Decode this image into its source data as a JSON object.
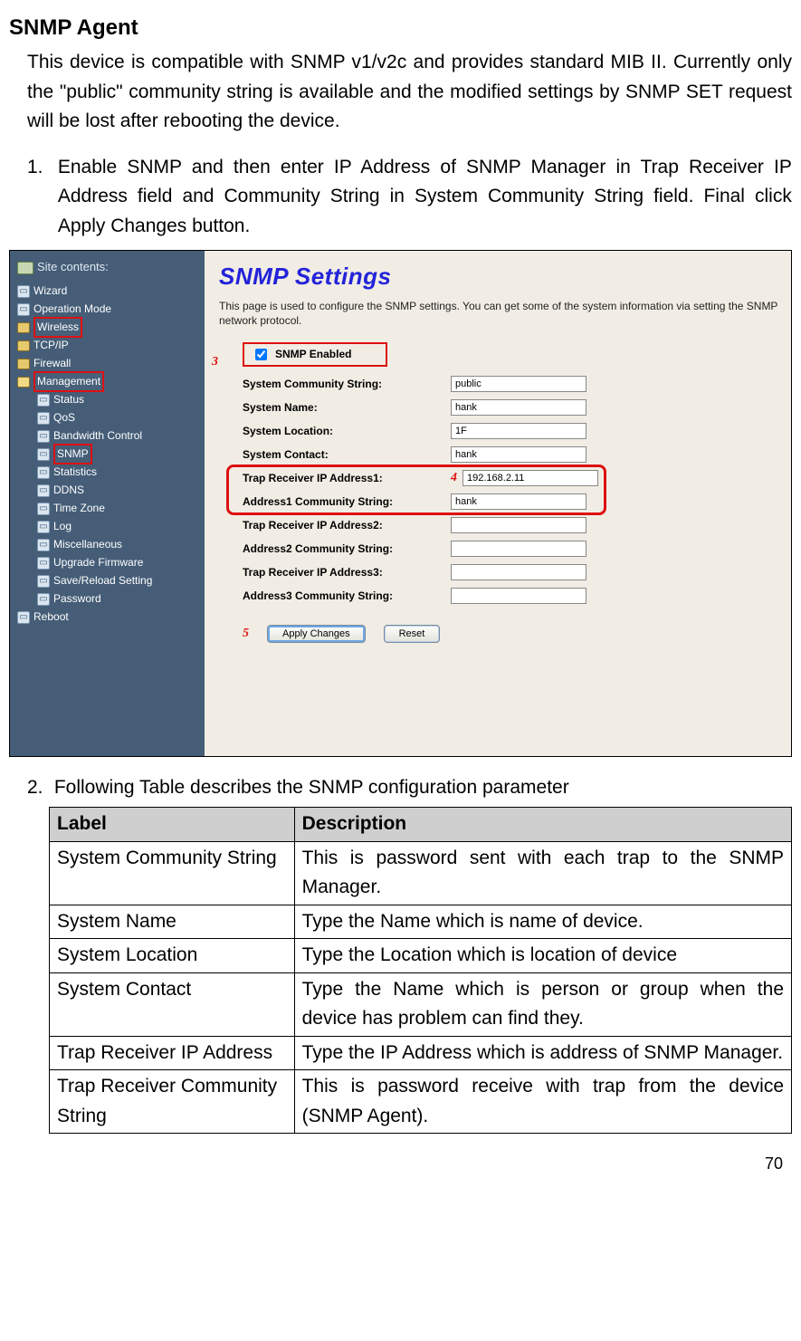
{
  "heading": "SNMP Agent",
  "intro": "This device is compatible with SNMP v1/v2c and provides standard MIB II. Currently only the \"public\" community string is available and the modified settings by SNMP SET request will be lost after rebooting the device.",
  "step1_num": "1.",
  "step1_text": "Enable SNMP and then enter IP Address of SNMP Manager in Trap Receiver IP Address field and Community String in System Community String field. Final click Apply Changes button.",
  "screenshot": {
    "sidebar": {
      "title": "Site contents:",
      "items": [
        {
          "label": "Wizard",
          "type": "doc"
        },
        {
          "label": "Operation Mode",
          "type": "doc"
        },
        {
          "label": "Wireless",
          "type": "folder",
          "box": "red"
        },
        {
          "label": "TCP/IP",
          "type": "folder"
        },
        {
          "label": "Firewall",
          "type": "folder"
        },
        {
          "label": "Management",
          "type": "folder-open",
          "box": "red"
        }
      ],
      "children": [
        {
          "label": "Status"
        },
        {
          "label": "QoS"
        },
        {
          "label": "Bandwidth Control"
        },
        {
          "label": "SNMP",
          "box": "red"
        },
        {
          "label": "Statistics"
        },
        {
          "label": "DDNS"
        },
        {
          "label": "Time Zone"
        },
        {
          "label": "Log"
        },
        {
          "label": "Miscellaneous"
        },
        {
          "label": "Upgrade Firmware"
        },
        {
          "label": "Save/Reload Setting"
        },
        {
          "label": "Password"
        }
      ],
      "reboot": "Reboot"
    },
    "content": {
      "title": "SNMP Settings",
      "desc": "This page is used to configure the SNMP settings. You can get some of the system information via setting the SNMP network protocol.",
      "callouts": {
        "enable": "3",
        "trap": "4",
        "apply": "5"
      },
      "enable_label": "SNMP Enabled",
      "fields": [
        {
          "label": "System Community String:",
          "value": "public"
        },
        {
          "label": "System Name:",
          "value": "hank"
        },
        {
          "label": "System Location:",
          "value": "1F"
        },
        {
          "label": "System Contact:",
          "value": "hank"
        },
        {
          "label": "Trap Receiver IP Address1:",
          "value": "192.168.2.11"
        },
        {
          "label": "Address1 Community String:",
          "value": "hank"
        },
        {
          "label": "Trap Receiver IP Address2:",
          "value": ""
        },
        {
          "label": "Address2 Community String:",
          "value": ""
        },
        {
          "label": "Trap Receiver IP Address3:",
          "value": ""
        },
        {
          "label": "Address3 Community String:",
          "value": ""
        }
      ],
      "buttons": {
        "apply": "Apply Changes",
        "reset": "Reset"
      }
    }
  },
  "step2_num": "2.",
  "step2_text": "Following Table describes the SNMP configuration parameter",
  "table": {
    "headers": {
      "label": "Label",
      "desc": "Description"
    },
    "rows": [
      {
        "label": "System Community String",
        "desc": "This is password sent with each trap to the SNMP Manager."
      },
      {
        "label": "System Name",
        "desc": "Type the Name which is name of device."
      },
      {
        "label": "System Location",
        "desc": "Type the Location which is location of device"
      },
      {
        "label": "System Contact",
        "desc": "Type the Name which is person or group when the device has problem can find they."
      },
      {
        "label": "Trap Receiver IP Address",
        "desc": "Type the IP Address which is address of SNMP Manager."
      },
      {
        "label": "Trap Receiver Community String",
        "desc": "This is password receive with trap from the device (SNMP Agent)."
      }
    ]
  },
  "page_number": "70"
}
